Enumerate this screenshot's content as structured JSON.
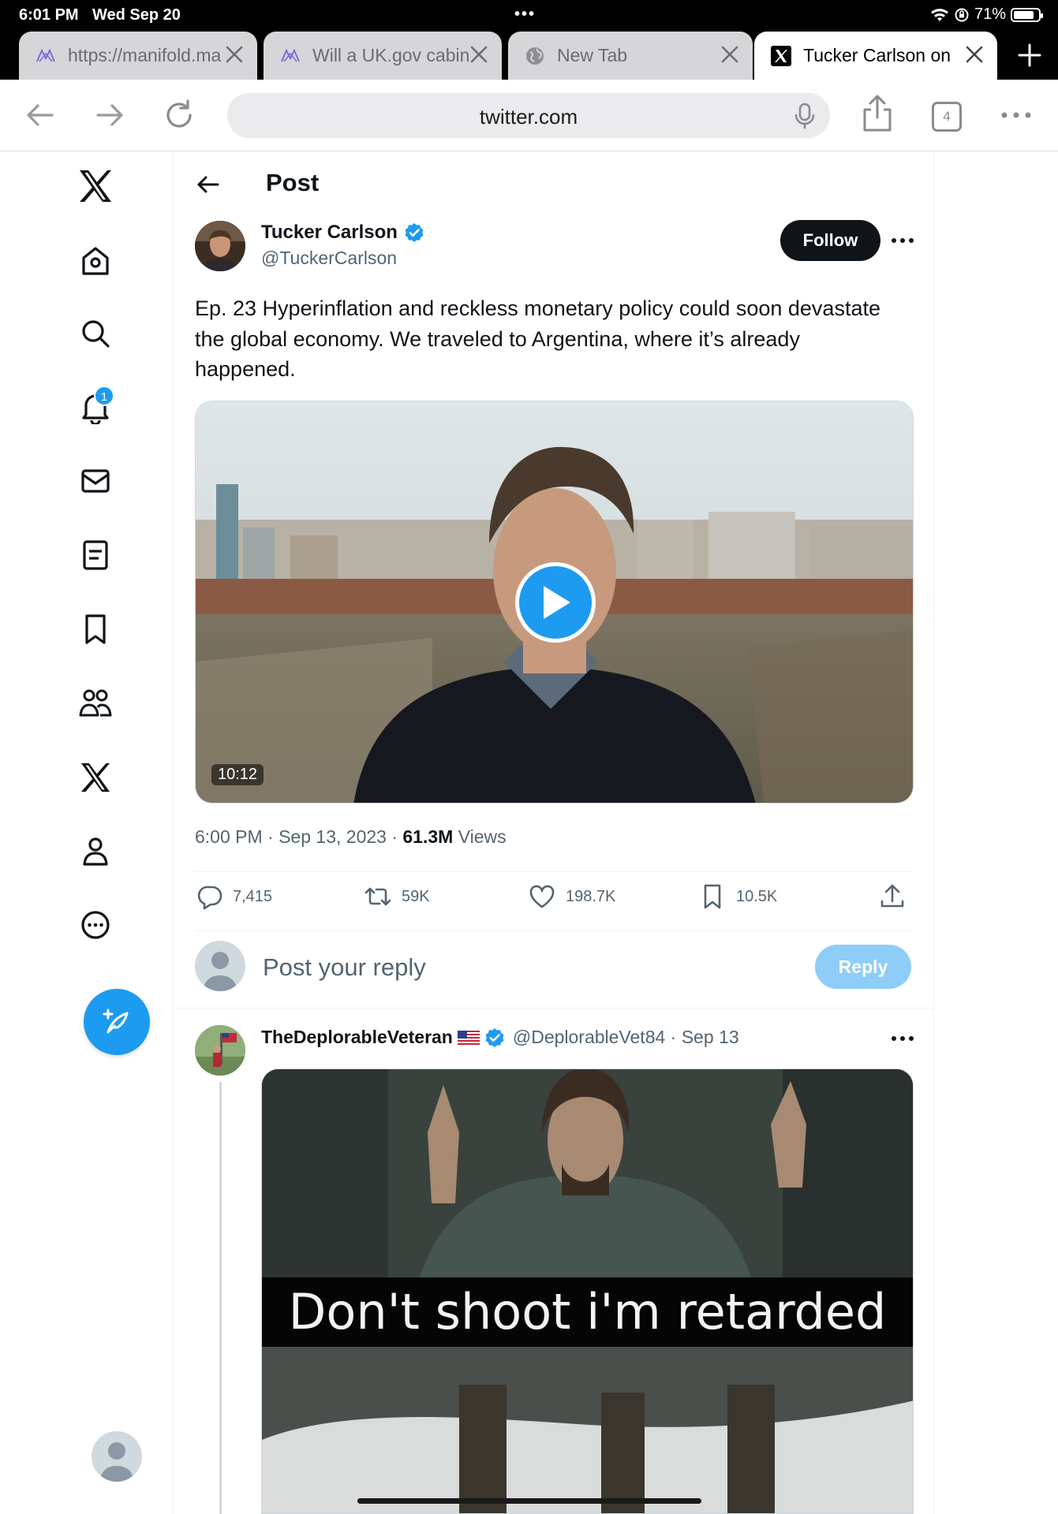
{
  "status_bar": {
    "time": "6:01 PM",
    "date": "Wed Sep 20",
    "battery": "71%"
  },
  "browser": {
    "tabs": [
      {
        "label": "https://manifold.ma",
        "icon": "manifold-icon",
        "active": false
      },
      {
        "label": "Will a UK.gov cabin",
        "icon": "manifold-icon",
        "active": false
      },
      {
        "label": "New Tab",
        "icon": "globe-icon",
        "active": false
      },
      {
        "label": "Tucker Carlson on",
        "icon": "x-logo-icon",
        "active": true
      }
    ],
    "url": "twitter.com",
    "tab_count": "4"
  },
  "nav": {
    "items": [
      "x-logo-icon",
      "home-icon",
      "search-icon",
      "notifications-icon",
      "messages-icon",
      "lists-icon",
      "bookmarks-icon",
      "communities-icon",
      "premium-icon",
      "profile-icon",
      "more-icon"
    ],
    "notification_count": "1"
  },
  "post": {
    "header": "Post",
    "author_name": "Tucker Carlson",
    "author_handle": "@TuckerCarlson",
    "follow_label": "Follow",
    "text": "Ep. 23  Hyperinflation and reckless monetary policy could soon devastate the global economy. We traveled to Argentina, where it’s already happened.",
    "video_duration": "10:12",
    "timestamp": "6:00 PM · Sep 13, 2023 · ",
    "views_count": "61.3M",
    "views_label": " Views",
    "stats": {
      "replies": "7,415",
      "reposts": "59K",
      "likes": "198.7K",
      "bookmarks": "10.5K"
    }
  },
  "reply_box": {
    "placeholder": "Post your reply",
    "button_label": "Reply"
  },
  "reply": {
    "author_name": "TheDeplorableVeteran",
    "author_handle": "@DeplorableVet84 · Sep 13",
    "image_caption": "Don't shoot i'm retarded"
  },
  "colors": {
    "accent": "#1d9bf0",
    "text": "#0f1419",
    "muted": "#536471",
    "border": "#eff3f4"
  }
}
